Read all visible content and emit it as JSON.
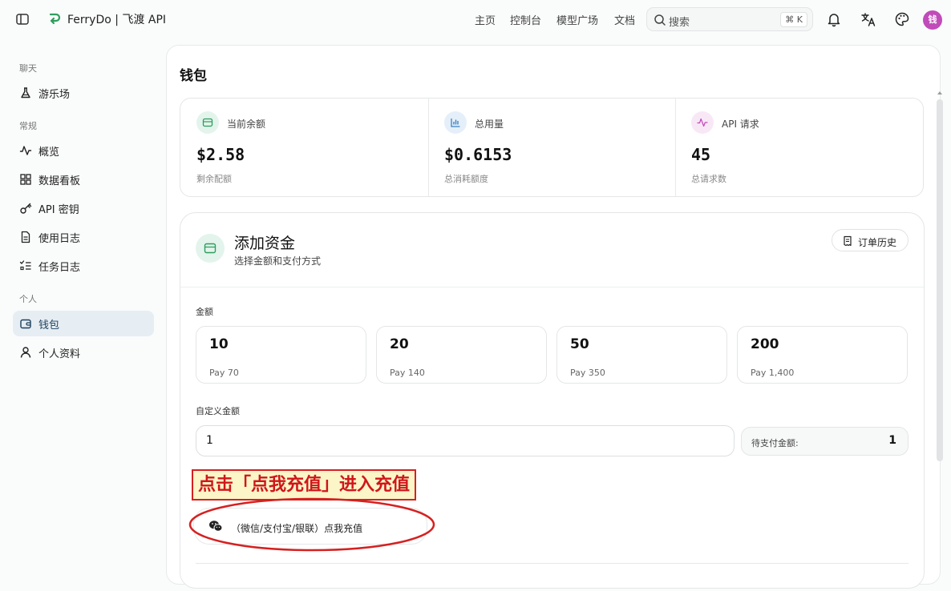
{
  "header": {
    "brand": "FerryDo | 飞渡 API",
    "nav": [
      "主页",
      "控制台",
      "模型广场",
      "文档"
    ],
    "search_placeholder": "搜索",
    "search_shortcut": "⌘ K",
    "avatar_text": "钱",
    "accent_color": "#2f9d5e",
    "avatar_color": "#c04bb9"
  },
  "sidebar": {
    "sections": [
      {
        "title": "聊天",
        "items": [
          {
            "label": "游乐场",
            "icon": "flask-icon"
          }
        ]
      },
      {
        "title": "常规",
        "items": [
          {
            "label": "概览",
            "icon": "activity-icon"
          },
          {
            "label": "数据看板",
            "icon": "grid-icon"
          },
          {
            "label": "API 密钥",
            "icon": "key-icon"
          },
          {
            "label": "使用日志",
            "icon": "file-icon"
          },
          {
            "label": "任务日志",
            "icon": "list-check-icon"
          }
        ]
      },
      {
        "title": "个人",
        "items": [
          {
            "label": "钱包",
            "icon": "wallet-icon",
            "active": true
          },
          {
            "label": "个人资料",
            "icon": "user-icon"
          }
        ]
      }
    ]
  },
  "page": {
    "title": "钱包",
    "stats": [
      {
        "label": "当前余额",
        "value": "$2.58",
        "sub": "剩余配额",
        "icon": "wallet-icon",
        "color": "#2f9d5e"
      },
      {
        "label": "总用量",
        "value": "$0.6153",
        "sub": "总消耗额度",
        "icon": "bar-chart-icon",
        "color": "#3b82c4"
      },
      {
        "label": "API 请求",
        "value": "45",
        "sub": "总请求数",
        "icon": "activity-icon",
        "color": "#c04bb9"
      }
    ],
    "fund": {
      "title": "添加资金",
      "subtitle": "选择金额和支付方式",
      "orders_label": "订单历史",
      "amount_label": "金额",
      "amounts": [
        {
          "value": "10",
          "pay": "Pay 70"
        },
        {
          "value": "20",
          "pay": "Pay 140"
        },
        {
          "value": "50",
          "pay": "Pay 350"
        },
        {
          "value": "200",
          "pay": "Pay 1,400"
        }
      ],
      "custom_label": "自定义金额",
      "custom_value": "1",
      "due_label": "待支付金额:",
      "due_value": "1",
      "annotation": "点击「点我充值」进入充值",
      "pay_button": "（微信/支付宝/银联）点我充值"
    }
  }
}
